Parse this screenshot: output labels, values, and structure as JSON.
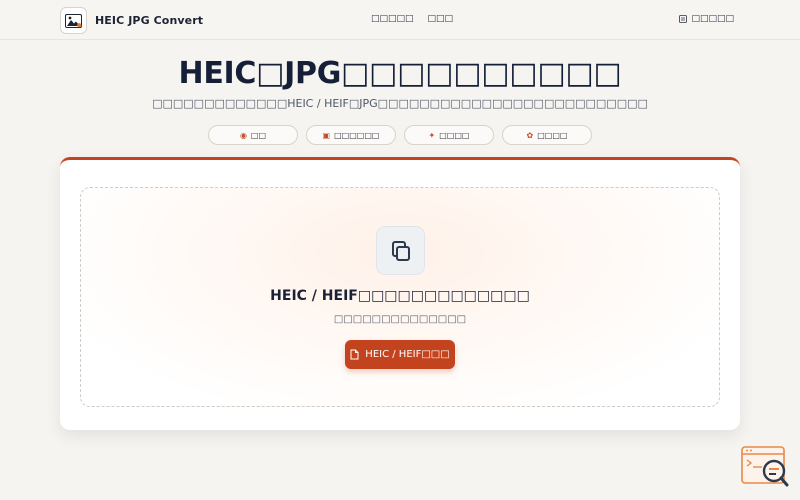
{
  "header": {
    "brand": "HEIC JPG Convert",
    "nav": [
      "□□□□□",
      "□□□"
    ],
    "language": "□□□□□"
  },
  "hero": {
    "title": "HEIC□JPG□□□□□□□□□□",
    "subtitle": "□□□□□□□□□□□□□HEIC / HEIF□JPG□□□□□□□□□□□□□□□□□□□□□□□□□□"
  },
  "pills": [
    {
      "icon": "shield-icon",
      "label": "□□"
    },
    {
      "icon": "image-icon",
      "label": "□□□□□□"
    },
    {
      "icon": "bolt-icon",
      "label": "□□□□"
    },
    {
      "icon": "sparkle-icon",
      "label": "□□□□"
    }
  ],
  "dropzone": {
    "title": "HEIC / HEIF□□□□□□□□□□□□□",
    "subtitle": "□□□□□□□□□□□□□□",
    "button": "HEIC / HEIF□□□"
  },
  "colors": {
    "accent": "#c4431f",
    "background": "#f6f4f1",
    "title": "#152038"
  }
}
